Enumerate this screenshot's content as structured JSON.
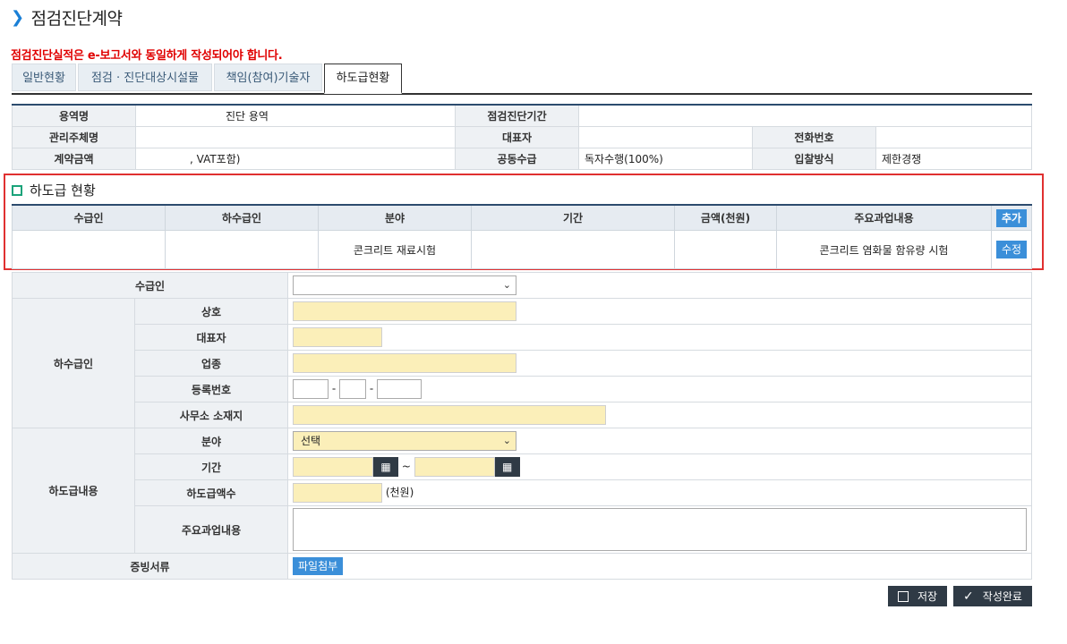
{
  "page": {
    "title": "점검진단계약",
    "warning": "점검진단실적은 e-보고서와 동일하게 작성되어야 합니다."
  },
  "tabs": [
    "일반현황",
    "점검 · 진단대상시설물",
    "책임(참여)기술자",
    "하도급현황"
  ],
  "info": {
    "service_name_label": "용역명",
    "service_name_value": "진단 용역",
    "period_label": "점검진단기간",
    "period_value": "",
    "manager_label": "관리주체명",
    "manager_value": "",
    "ceo_label": "대표자",
    "ceo_value": "",
    "phone_label": "전화번호",
    "phone_value": "",
    "amount_label": "계약금액",
    "amount_value": ", VAT포함)",
    "joint_label": "공동수급",
    "joint_value": "독자수행(100%)",
    "bid_label": "입찰방식",
    "bid_value": "제한경쟁"
  },
  "subcontract": {
    "heading": "하도급 현황",
    "columns": [
      "수급인",
      "하수급인",
      "분야",
      "기간",
      "금액(천원)",
      "주요과업내용"
    ],
    "add_label": "추가",
    "edit_label": "수정",
    "rows": [
      [
        "",
        "",
        "콘크리트 재료시험",
        "",
        "",
        "콘크리트 염화물 함유량 시험"
      ]
    ]
  },
  "form": {
    "contractor_label": "수급인",
    "subcontractor_label": "하수급인",
    "company_label": "상호",
    "ceo_label": "대표자",
    "business_label": "업종",
    "regno_label": "등록번호",
    "regno_sep": "-",
    "address_label": "사무소 소재지",
    "content_section_label": "하도급내용",
    "field_label": "분야",
    "field_value": "선택",
    "period_label": "기간",
    "period_sep": "~",
    "amount_label": "하도급액수",
    "amount_unit": "(천원)",
    "task_label": "주요과업내용",
    "docs_label": "증빙서류",
    "attach_label": "파일첨부"
  },
  "footer": {
    "save_label": "저장",
    "complete_label": "작성완료"
  }
}
